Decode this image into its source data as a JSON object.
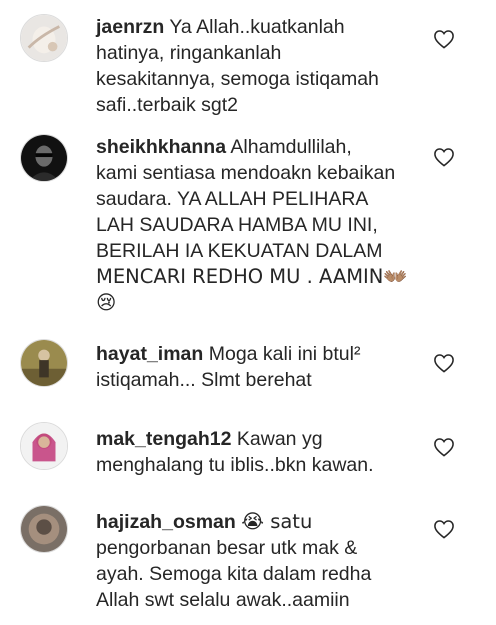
{
  "comments": [
    {
      "username": "jaenrzn",
      "lines": [
        "Ya Allah..kuatkanlah",
        "hatinya, ringankanlah",
        "kesakitannya, semoga istiqamah",
        "safi..terbaik sgt2"
      ],
      "like_icon": "heart-outline-icon"
    },
    {
      "username": "sheikhkhanna",
      "lines": [
        "Alhamdullilah,",
        "kami sentiasa mendoakn kebaikan",
        "saudara. YA ALLAH PELIHARA",
        "LAH SAUDARA HAMBA MU INI,",
        "BERILAH IA KEKUATAN DALAM",
        "MENCARI REDHO MU . AAMIN👐🏽",
        "😢"
      ],
      "like_icon": "heart-outline-icon"
    },
    {
      "username": "hayat_iman",
      "lines": [
        "Moga kali ini btul²",
        "istiqamah... Slmt berehat"
      ],
      "like_icon": "heart-outline-icon"
    },
    {
      "username": "mak_tengah12",
      "lines": [
        "Kawan yg",
        "menghalang tu iblis..bkn kawan."
      ],
      "like_icon": "heart-outline-icon"
    },
    {
      "username": "hajizah_osman",
      "lines": [
        "😭 satu",
        "pengorbanan besar utk mak &",
        "ayah. Semoga kita dalam redha",
        "Allah swt selalu awak..aamiin"
      ],
      "like_icon": "heart-outline-icon"
    }
  ]
}
